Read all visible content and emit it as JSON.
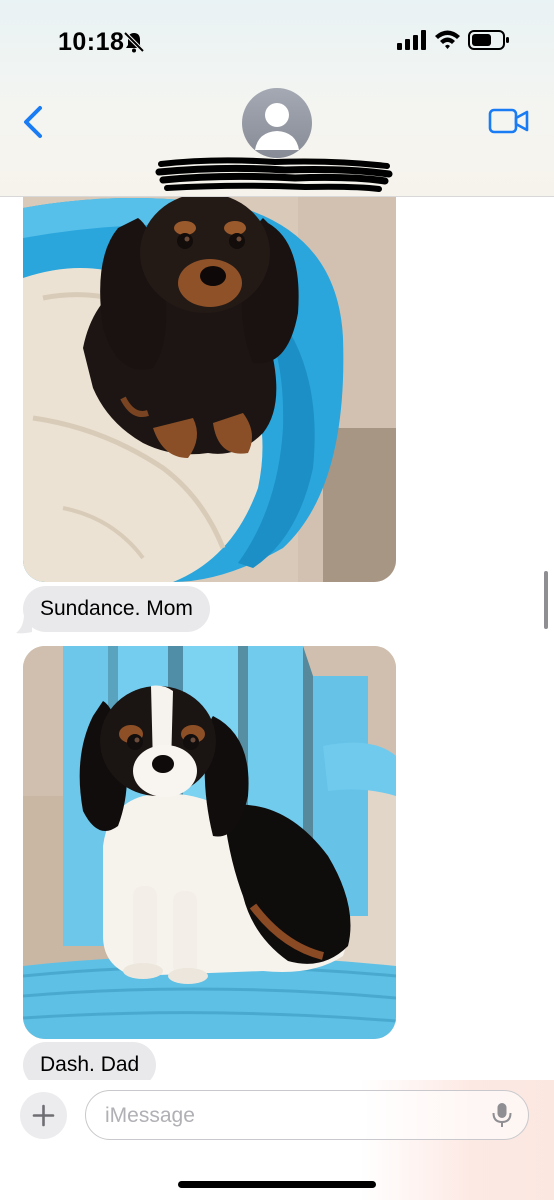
{
  "status_bar": {
    "time": "10:18",
    "icons": [
      "bell-slash-icon",
      "cellular-signal-icon",
      "wifi-icon",
      "battery-icon"
    ]
  },
  "header": {
    "back_icon": "chevron-left-icon",
    "avatar_icon": "person-silhouette-icon",
    "contact_name": "",
    "contact_name_redacted": true,
    "video_icon": "video-camera-icon",
    "accent_color": "#1a7cf5"
  },
  "messages": [
    {
      "type": "image",
      "description_icon": "photo-dog-black-tan-in-blue-pool"
    },
    {
      "type": "text",
      "text": "Sundance. Mom"
    },
    {
      "type": "image",
      "description_icon": "photo-dog-tricolor-on-blue-chair"
    },
    {
      "type": "text",
      "text": "Dash. Dad"
    }
  ],
  "composer": {
    "add_icon": "plus-icon",
    "placeholder": "iMessage",
    "value": "",
    "mic_icon": "microphone-icon"
  },
  "colors": {
    "incoming_bubble": "#e9e9eb",
    "accent": "#1a7cf5"
  }
}
